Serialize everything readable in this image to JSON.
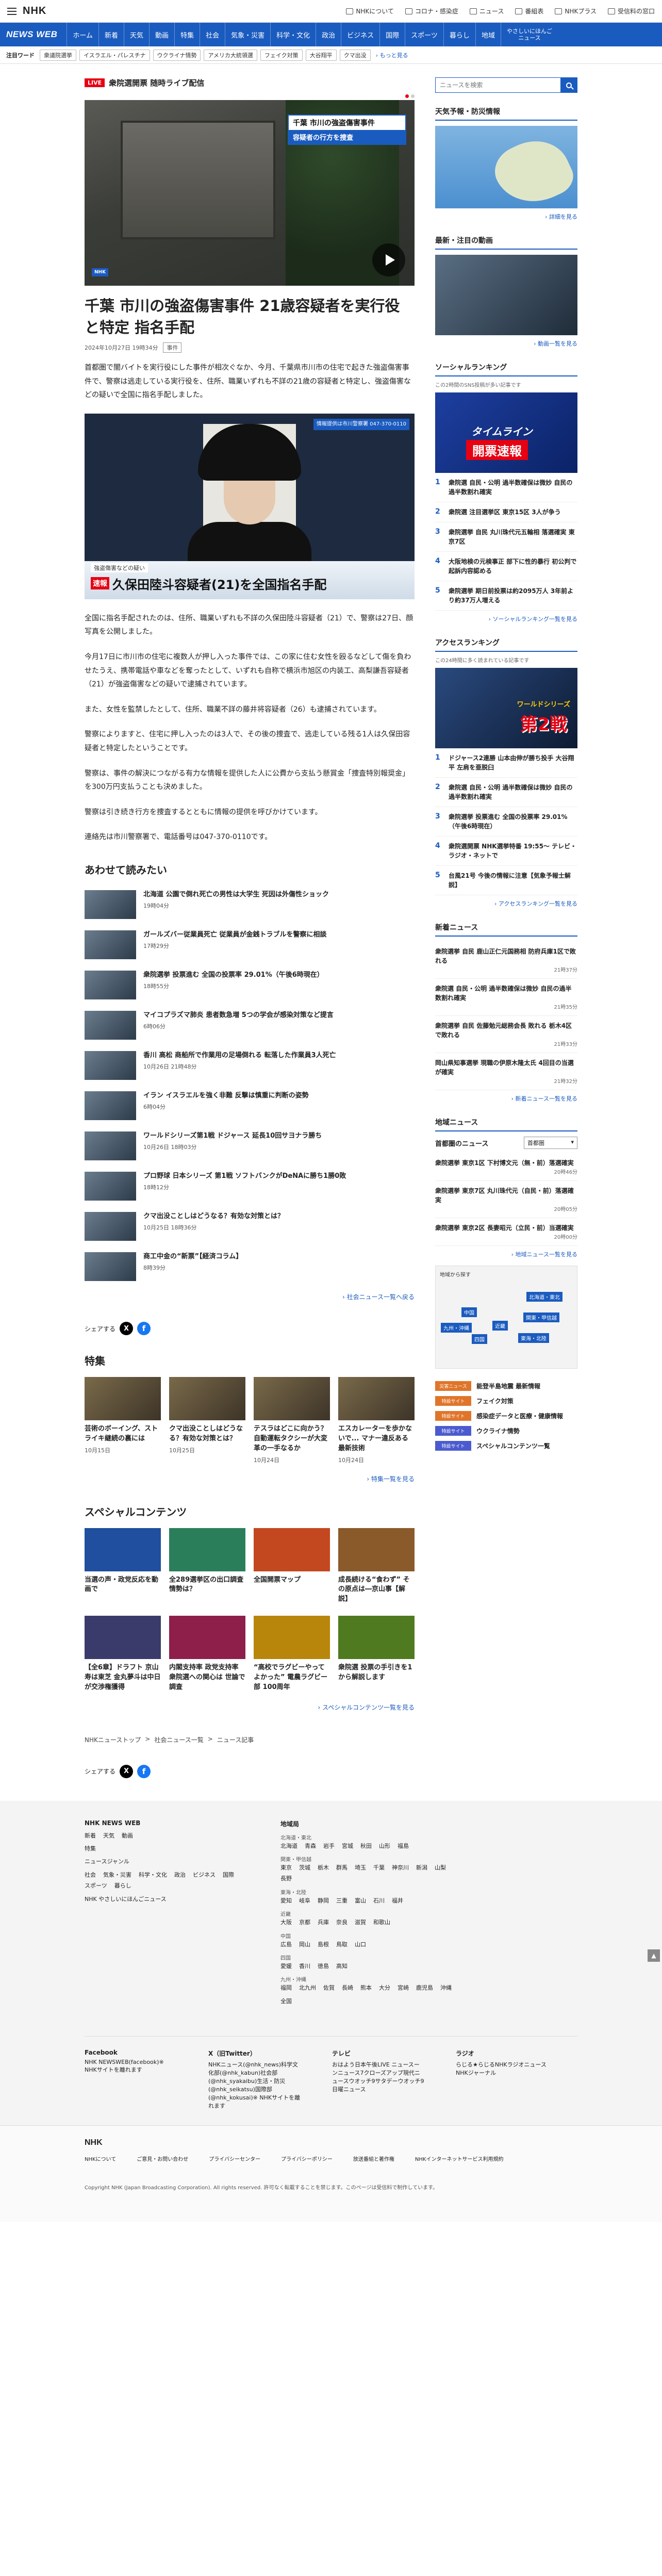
{
  "header": {
    "logo": "NHK",
    "links": [
      "NHKについて",
      "コロナ・感染症",
      "ニュース",
      "番組表",
      "NHKプラス",
      "受信料の窓口"
    ]
  },
  "nav": {
    "logo": "NEWS WEB",
    "items": [
      "ホーム",
      "新着",
      "天気",
      "動画",
      "特集",
      "社会",
      "気象・災害",
      "科学・文化",
      "政治",
      "ビジネス",
      "国際",
      "スポーツ",
      "暮らし",
      "地域"
    ],
    "easy": "やさしいにほんご\nニュース"
  },
  "topics": {
    "label": "注目ワード",
    "chips": [
      "衆議院選挙",
      "イスラエル・パレスチナ",
      "ウクライナ情勢",
      "アメリカ大統領選",
      "フェイク対策",
      "大谷翔平",
      "クマ出没"
    ],
    "more": "もっと見る"
  },
  "live": {
    "badge": "LIVE",
    "title": "衆院選開票 随時ライブ配信"
  },
  "hero": {
    "caption1": "千葉 市川の強盗傷害事件",
    "caption2": "容疑者の行方を捜査",
    "badge": "NHK"
  },
  "article": {
    "title": "千葉 市川の強盗傷害事件 21歳容疑者を実行役と特定 指名手配",
    "date": "2024年10月27日 19時34分",
    "tag": "事件",
    "lead": "首都圏で闇バイトを実行役にした事件が相次ぐなか、今月、千葉県市川市の住宅で起きた強盗傷害事件で、警察は逃走している実行役を、住所、職業いずれも不詳の21歳の容疑者と特定し、強盗傷害などの疑いで全国に指名手配しました。",
    "p1": "全国に指名手配されたのは、住所、職業いずれも不詳の久保田陸斗容疑者（21）で、警察は27日、顔写真を公開しました。",
    "p2": "今月17日に市川市の住宅に複数人が押し入った事件では、この家に住む女性を殴るなどして傷を負わせたうえ、携帯電話や車などを奪ったとして、いずれも自称で横浜市旭区の内装工、高梨謙吾容疑者（21）が強盗傷害などの疑いで逮捕されています。",
    "p3": "また、女性を監禁したとして、住所、職業不詳の藤井将容疑者（26）も逮捕されています。",
    "p4": "警察によりますと、住宅に押し入ったのは3人で、その後の捜査で、逃走している残る1人は久保田容疑者と特定したということです。",
    "p5": "警察は、事件の解決につながる有力な情報を提供した人に公費から支払う懸賞金「捜査特別報奨金」を300万円支払うことも決めました。",
    "p6": "警察は引き続き行方を捜査するとともに情報の提供を呼びかけています。",
    "p7": "連絡先は市川警察署で、電話番号は047-370-0110です。"
  },
  "photo": {
    "tel": "情報提供は市川警察署 047-370-0110",
    "sub": "強盗傷害などの疑い",
    "badge": "速報",
    "main": "久保田陸斗容疑者(21)を全国指名手配"
  },
  "related": {
    "heading": "あわせて読みたい",
    "items": [
      {
        "title": "北海道 公園で倒れ死亡の男性は大学生 死因は外傷性ショック",
        "date": "19時04分"
      },
      {
        "title": "ガールズバー従業員死亡 従業員が金銭トラブルを警察に相談",
        "date": "17時29分"
      },
      {
        "title": "衆院選挙 投票進む 全国の投票率 29.01%（午後6時現在）",
        "date": "18時55分"
      },
      {
        "title": "マイコプラズマ肺炎 患者数急増 5つの学会が感染対策など提言",
        "date": "6時06分"
      },
      {
        "title": "香川 高松 商船所で作業用の足場倒れる 転落した作業員3人死亡",
        "date": "10月26日 21時48分"
      },
      {
        "title": "イラン イスラエルを強く非難 反撃は慎重に判断の姿勢",
        "date": "6時04分"
      },
      {
        "title": "ワールドシリーズ第1戦 ドジャース 延長10回サヨナラ勝ち",
        "date": "10月26日 18時03分"
      },
      {
        "title": "プロ野球 日本シリーズ 第1戦 ソフトバンクがDeNAに勝ち1勝0敗",
        "date": "18時12分"
      },
      {
        "title": "クマ出没ことしはどうなる？有効な対策とは？",
        "date": "10月25日 18時36分"
      },
      {
        "title": "商工中金の“新票”【経済コラム】",
        "date": "8時39分"
      }
    ],
    "more": "社会ニュース一覧へ戻る"
  },
  "share": {
    "label": "シェアする",
    "x": "X",
    "fb": "f"
  },
  "features": {
    "heading": "特集",
    "items": [
      {
        "title": "芸術のボーイング、ストライキ継続の裏には",
        "date": "10月15日"
      },
      {
        "title": "クマ出没ことしはどうなる？有効な対策とは？",
        "date": "10月25日"
      },
      {
        "title": "テスラはどこに向かう？自動運転タクシーが大変革の一手なるか",
        "date": "10月24日"
      },
      {
        "title": "エスカレーターを歩かないで... マナー違反ある最新技術",
        "date": "10月24日"
      }
    ],
    "more": "特集一覧を見る"
  },
  "special": {
    "heading": "スペシャルコンテンツ",
    "items": [
      {
        "title": "当選の声・政党反応を動画で"
      },
      {
        "title": "全289選挙区の出口調査 情勢は？"
      },
      {
        "title": "全国開票マップ"
      },
      {
        "title": "成長続ける“食わず” その原点は―京山事【解説】"
      },
      {
        "title": "【全6章】ドラフト 京山寿は東芝 金丸夢斗は中日が交渉権獲得"
      },
      {
        "title": "内閣支持率 政党支持率 衆院選への関心は 世論で調査"
      },
      {
        "title": "“高校でラグビーやってよかった” 電農ラグビー部 100周年"
      },
      {
        "title": "衆院選 投票の手引きを1から解説します"
      }
    ],
    "more": "スペシャルコンテンツ一覧を見る"
  },
  "breadcrumb": [
    "NHKニューストップ",
    "社会ニュース一覧",
    "ニュース記事"
  ],
  "sidebar": {
    "search_placeholder": "ニュースを検索",
    "weather": {
      "heading": "天気予報・防災情報",
      "more": "詳細を見る"
    },
    "video": {
      "heading": "最新・注目の動画",
      "more": "動画一覧を見る"
    },
    "social": {
      "heading": "ソーシャルランキング",
      "sub": "この2時間のSNS投稿が多い記事です",
      "banner1": "タイムライン",
      "banner2": "開票速報",
      "items": [
        "衆院選 自民・公明 過半数確保は微妙 自民の過半数割れ確実",
        "衆院選 注目選挙区 東京15区 3人が争う",
        "衆院選挙 自民 丸川珠代元五輪相 落選確実 東京7区",
        "大阪地検の元検事正 部下に性的暴行 初公判で起訴内容認める",
        "衆院選挙 期日前投票は約2095万人 3年前より約37万人増える"
      ],
      "more": "ソーシャルランキング一覧を見る"
    },
    "access": {
      "heading": "アクセスランキング",
      "sub": "この24時間に多く読まれている記事です",
      "banner1": "ワールドシリーズ",
      "banner2": "第2戦",
      "items": [
        "ドジャース2連勝 山本由伸が勝ち投手 大谷翔平 左肩を亜脱臼",
        "衆院選 自民・公明 過半数確保は微妙 自民の過半数割れ確実",
        "衆院選挙 投票進む 全国の投票率 29.01%（午後6時現在）",
        "衆院選開票 NHK選挙特番 19:55〜 テレビ・ラジオ・ネットで",
        "台風21号 今後の情報に注意【気象予報士解説】"
      ],
      "more": "アクセスランキング一覧を見る"
    },
    "latest": {
      "heading": "新着ニュース",
      "items": [
        {
          "title": "衆院選挙 自民 鹿山正仁元国務相 防府兵庫1区で敗れる",
          "date": "21時37分"
        },
        {
          "title": "衆院選 自民・公明 過半数確保は微妙 自民の過半数割れ確実",
          "date": "21時35分"
        },
        {
          "title": "衆院選挙 自民 佐藤勉元総務会長 敗れる 栃木4区で敗れる",
          "date": "21時33分"
        },
        {
          "title": "岡山県知事選挙 現職の伊原木隆太氏 4回目の当選が確実",
          "date": "21時32分"
        }
      ],
      "more": "新着ニュース一覧を見る"
    },
    "regional": {
      "heading": "地域ニュース",
      "label": "首都圏のニュース",
      "select": "首都圏",
      "items": [
        {
          "title": "衆院選挙 東京1区 下村博文元（無・前）落選確実",
          "date": "20時46分"
        },
        {
          "title": "衆院選挙 東京7区 丸川珠代元（自民・前）落選確実",
          "date": "20時05分"
        },
        {
          "title": "衆院選挙 東京2区 長妻昭元（立民・前）当選確実",
          "date": "20時00分"
        }
      ],
      "more": "地域ニュース一覧を見る",
      "map_title": "地域から探す",
      "regions": [
        "北海道・東北",
        "関東・甲信越",
        "東海・北陸",
        "近畿",
        "中国",
        "四国",
        "九州・沖縄"
      ]
    },
    "specials": [
      {
        "badge": "災害ニュース",
        "text": "能登半島地震 最新情報"
      },
      {
        "badge": "特設サイト",
        "text": "フェイク対策"
      },
      {
        "badge": "特設サイト",
        "text": "感染症データと医療・健康情報"
      },
      {
        "badge": "特設サイト",
        "text": "ウクライナ情勢"
      },
      {
        "badge": "特設サイト",
        "text": "スペシャルコンテンツ一覧"
      }
    ]
  },
  "footer": {
    "col1_h": "NHK NEWS WEB",
    "col1_rows": [
      [
        "新着",
        "天気",
        "動画"
      ],
      [
        "特集"
      ],
      [
        "ニュースジャンル"
      ],
      [
        "社会",
        "気象・災害",
        "科学・文化",
        "政治",
        "ビジネス",
        "国際",
        "スポーツ",
        "暮らし"
      ],
      [
        "NHK やさしいにほんごニュース"
      ]
    ],
    "col2_h": "地域局",
    "col2_rows": [
      {
        "sub": "北海道・東北",
        "items": [
          "北海道",
          "青森",
          "岩手",
          "宮城",
          "秋田",
          "山形",
          "福島"
        ]
      },
      {
        "sub": "関東・甲信越",
        "items": [
          "東京",
          "茨城",
          "栃木",
          "群馬",
          "埼玉",
          "千葉",
          "神奈川",
          "新潟",
          "山梨",
          "長野"
        ]
      },
      {
        "sub": "東海・北陸",
        "items": [
          "愛知",
          "岐阜",
          "静岡",
          "三重",
          "富山",
          "石川",
          "福井"
        ]
      },
      {
        "sub": "近畿",
        "items": [
          "大阪",
          "京都",
          "兵庫",
          "奈良",
          "滋賀",
          "和歌山"
        ]
      },
      {
        "sub": "中国",
        "items": [
          "広島",
          "岡山",
          "島根",
          "鳥取",
          "山口"
        ]
      },
      {
        "sub": "四国",
        "items": [
          "愛媛",
          "香川",
          "徳島",
          "高知"
        ]
      },
      {
        "sub": "九州・沖縄",
        "items": [
          "福岡",
          "北九州",
          "佐賀",
          "長崎",
          "熊本",
          "大分",
          "宮崎",
          "鹿児島",
          "沖縄"
        ]
      },
      {
        "sub": "",
        "items": [
          "全国"
        ]
      }
    ],
    "social_cols": [
      {
        "h": "Facebook",
        "items": [
          "NHK NEWSWEB(facebook)",
          "※ NHKサイトを離れます"
        ]
      },
      {
        "h": "X（旧Twitter）",
        "items": [
          "NHKニュース(@nhk_news)",
          "科学文化部(@nhk_kabun)",
          "社会部(@nhk_syakaibu)",
          "生活・防災(@nhk_seikatsu)",
          "国際部(@nhk_kokusai)",
          "※ NHKサイトを離れます"
        ]
      },
      {
        "h": "テレビ",
        "items": [
          "おはよう日本",
          "午後LIVE ニュースーン",
          "ニュース7",
          "クローズアップ現代",
          "ニュースウオッチ9",
          "サタデーウオッチ9",
          "日曜ニュース"
        ]
      },
      {
        "h": "ラジオ",
        "items": [
          "らじる★らじる",
          "NHKラジオニュース",
          "NHKジャーナル"
        ]
      }
    ]
  },
  "bottom": {
    "logo": "NHK",
    "links": [
      "NHKについて",
      "ご意見・お問い合わせ",
      "プライバシーセンター",
      "プライバシーポリシー",
      "放送番組と著作権",
      "NHKインターネットサービス利用規約"
    ],
    "copyright": "Copyright NHK (Japan Broadcasting Corporation). All rights reserved. 許可なく転載することを禁じます。このページは受信料で制作しています。"
  }
}
